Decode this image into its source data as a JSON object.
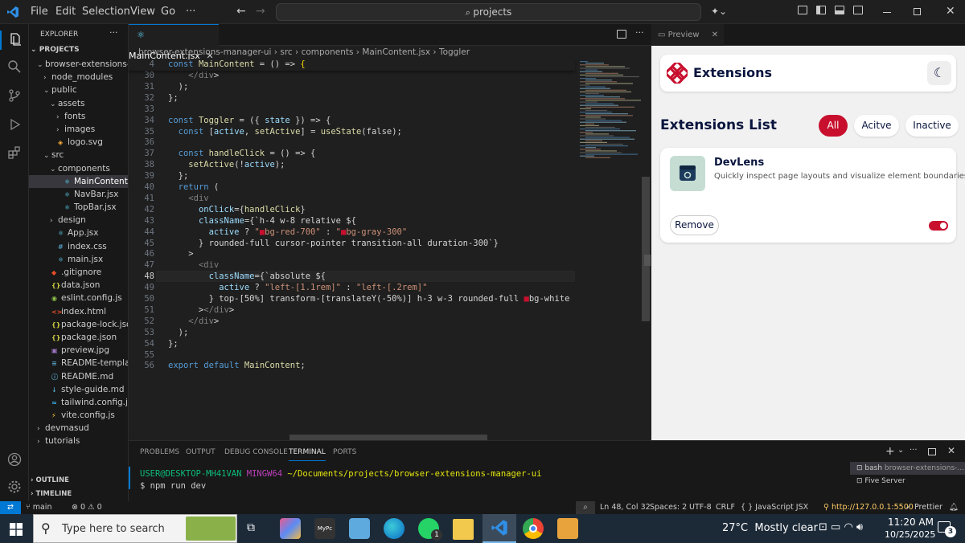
{
  "titlebar": {
    "menu": [
      "File",
      "Edit",
      "Selection",
      "View",
      "Go",
      "···"
    ],
    "search_text": "projects"
  },
  "sidebar": {
    "title": "EXPLORER",
    "section": "PROJECTS",
    "items": [
      {
        "label": "browser-extensions-...",
        "depth": 1,
        "chevron": "⌄",
        "icon": ""
      },
      {
        "label": "node_modules",
        "depth": 2,
        "chevron": "›",
        "icon": ""
      },
      {
        "label": "public",
        "depth": 2,
        "chevron": "⌄",
        "icon": ""
      },
      {
        "label": "assets",
        "depth": 3,
        "chevron": "⌄",
        "icon": ""
      },
      {
        "label": "fonts",
        "depth": 4,
        "chevron": "›",
        "icon": ""
      },
      {
        "label": "images",
        "depth": 4,
        "chevron": "›",
        "icon": ""
      },
      {
        "label": "logo.svg",
        "depth": 3,
        "chevron": "",
        "icon": "◈"
      },
      {
        "label": "src",
        "depth": 2,
        "chevron": "⌄",
        "icon": ""
      },
      {
        "label": "components",
        "depth": 3,
        "chevron": "⌄",
        "icon": ""
      },
      {
        "label": "MainContent.jsx",
        "depth": 4,
        "chevron": "",
        "icon": "⚛"
      },
      {
        "label": "NavBar.jsx",
        "depth": 4,
        "chevron": "",
        "icon": "⚛"
      },
      {
        "label": "TopBar.jsx",
        "depth": 4,
        "chevron": "",
        "icon": "⚛"
      },
      {
        "label": "design",
        "depth": 3,
        "chevron": "›",
        "icon": ""
      },
      {
        "label": "App.jsx",
        "depth": 3,
        "chevron": "",
        "icon": "⚛"
      },
      {
        "label": "index.css",
        "depth": 3,
        "chevron": "",
        "icon": "#"
      },
      {
        "label": "main.jsx",
        "depth": 3,
        "chevron": "",
        "icon": "⚛"
      },
      {
        "label": ".gitignore",
        "depth": 2,
        "chevron": "",
        "icon": "◆"
      },
      {
        "label": "data.json",
        "depth": 2,
        "chevron": "",
        "icon": "{}"
      },
      {
        "label": "eslint.config.js",
        "depth": 2,
        "chevron": "",
        "icon": "◉"
      },
      {
        "label": "index.html",
        "depth": 2,
        "chevron": "",
        "icon": "<>"
      },
      {
        "label": "package-lock.json",
        "depth": 2,
        "chevron": "",
        "icon": "{}"
      },
      {
        "label": "package.json",
        "depth": 2,
        "chevron": "",
        "icon": "{}"
      },
      {
        "label": "preview.jpg",
        "depth": 2,
        "chevron": "",
        "icon": "▣"
      },
      {
        "label": "README-template....",
        "depth": 2,
        "chevron": "",
        "icon": "≡"
      },
      {
        "label": "README.md",
        "depth": 2,
        "chevron": "",
        "icon": "ⓘ"
      },
      {
        "label": "style-guide.md",
        "depth": 2,
        "chevron": "",
        "icon": "↓"
      },
      {
        "label": "tailwind.config.js",
        "depth": 2,
        "chevron": "",
        "icon": "≈"
      },
      {
        "label": "vite.config.js",
        "depth": 2,
        "chevron": "",
        "icon": "⚡"
      },
      {
        "label": "devmasud",
        "depth": 1,
        "chevron": "›",
        "icon": ""
      },
      {
        "label": "tutorials",
        "depth": 1,
        "chevron": "›",
        "icon": ""
      }
    ],
    "outline": "OUTLINE",
    "timeline": "TIMELINE"
  },
  "editor": {
    "tab": "MainContent.jsx",
    "preview_tab": "Preview",
    "breadcrumb": [
      "browser-extensions-manager-ui",
      "src",
      "components",
      "MainContent.jsx",
      "Toggler"
    ],
    "sticky_line": {
      "num": "4",
      "text": "const MainContent = () => {"
    },
    "line_numbers": [
      "30",
      "31",
      "32",
      "33",
      "34",
      "35",
      "36",
      "37",
      "38",
      "39",
      "40",
      "41",
      "42",
      "43",
      "44",
      "45",
      "46",
      "47",
      "48",
      "49",
      "50",
      "51",
      "52",
      "53",
      "54",
      "55",
      "56"
    ],
    "code_lines": [
      "    </div>",
      "  );",
      "};",
      "",
      "const Toggler = ({ state }) => {",
      "  const [active, setActive] = useState(false);",
      "",
      "  const handleClick = () => {",
      "    setActive(!active);",
      "  };",
      "  return (",
      "    <div",
      "      onClick={handleClick}",
      "      className={`h-4 w-8 relative ${",
      "        active ? \"▪bg-red-700\" : \"▪bg-gray-300\"",
      "      } rounded-full cursor-pointer transition-all duration-300`}",
      "    >",
      "      <div",
      "        className={`absolute ${",
      "          active ? \"left-[1.1rem]\" : \"left-[.2rem]\"",
      "        } top-[50%] transform-[translateY(-50%)] h-3 w-3 rounded-full ▪bg-white transitio",
      "      ></div>",
      "    </div>",
      "  );",
      "};",
      "",
      "export default MainContent;"
    ]
  },
  "preview": {
    "brand": "Extensions",
    "list_title": "Extensions List",
    "filters": [
      "All",
      "Acitve",
      "Inactive"
    ],
    "card": {
      "name": "DevLens",
      "description": "Quickly inspect page layouts and visualize element boundaries.",
      "remove_label": "Remove",
      "toggle_on": 1
    },
    "colors": {
      "accent": "#c8102e",
      "bg": "#f1f1f1"
    }
  },
  "panel": {
    "tabs": [
      "PROBLEMS",
      "OUTPUT",
      "DEBUG CONSOLE",
      "TERMINAL",
      "PORTS"
    ],
    "active_tab": "TERMINAL",
    "prompt_user": "USER@DESKTOP-MH41VAN",
    "prompt_env": "MINGW64",
    "prompt_path": "~/Documents/projects/browser-extensions-manager-ui",
    "command": "$ npm run dev",
    "terminals": [
      {
        "name": "bash",
        "detail": "browser-extensions-..."
      },
      {
        "name": "Five Server",
        "detail": ""
      }
    ]
  },
  "statusbar": {
    "branch": "main",
    "problems": "⊗ 0 ⚠ 0",
    "position": "Ln 48, Col 32",
    "spaces": "Spaces: 2",
    "encoding": "UTF-8",
    "eol": "CRLF",
    "language": "{ } JavaScript JSX",
    "server": "http://127.0.0.1:5500",
    "prettier": "✓ Prettier"
  },
  "taskbar": {
    "search_placeholder": "Type here to search",
    "weather": "27°C  Mostly clear",
    "time": "11:20 AM",
    "date": "10/25/2025",
    "whatsapp_badge": "1",
    "notification_count": "3"
  }
}
